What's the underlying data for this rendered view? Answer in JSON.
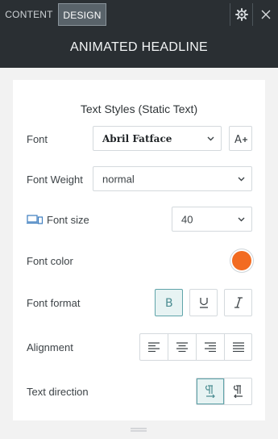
{
  "tabs": [
    {
      "label": "CONTENT",
      "active": false
    },
    {
      "label": "DESIGN",
      "active": true
    }
  ],
  "top_icons": [
    "gear-icon",
    "close-icon"
  ],
  "widget_title": "ANIMATED HEADLINE",
  "section_title": "Text Styles (Static Text)",
  "font": {
    "label": "Font",
    "value": "Abril Fatface",
    "icon": "font-adjust-icon"
  },
  "font_weight": {
    "label": "Font Weight",
    "value": "normal"
  },
  "font_size": {
    "label": "Font size",
    "value": "40",
    "icon": "responsive-devices-icon"
  },
  "font_color": {
    "label": "Font color",
    "color": "#f26b21"
  },
  "font_format": {
    "label": "Font format",
    "buttons": [
      {
        "name": "bold",
        "active": true
      },
      {
        "name": "underline",
        "active": false
      },
      {
        "name": "italic",
        "active": false
      }
    ]
  },
  "alignment": {
    "label": "Alignment",
    "options": [
      "align-left",
      "align-center",
      "align-right",
      "justify"
    ]
  },
  "text_direction": {
    "label": "Text direction",
    "options": [
      {
        "name": "left-to-right",
        "active": true
      },
      {
        "name": "right-to-left",
        "active": false
      }
    ]
  },
  "colors": {
    "accent": "#5fa4a9",
    "dark": "#2a2f33",
    "orange": "#f26b21"
  }
}
